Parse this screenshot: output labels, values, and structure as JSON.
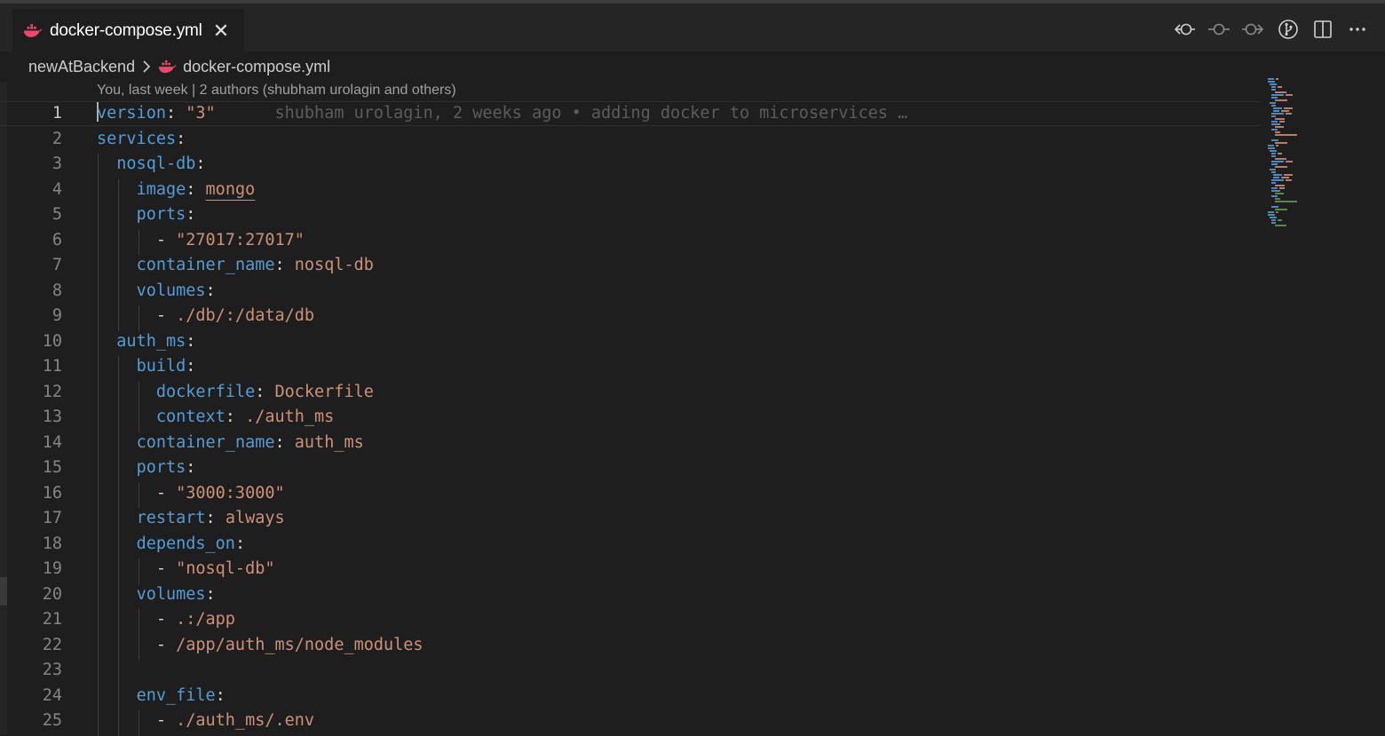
{
  "tab": {
    "label": "docker-compose.yml",
    "icon": "docker-whale-icon",
    "close_glyph": "✕"
  },
  "actions": [
    {
      "name": "open-previous-change-button",
      "icon": "arrow-left-commit-icon"
    },
    {
      "name": "open-changes-button",
      "icon": "commit-icon"
    },
    {
      "name": "open-next-change-button",
      "icon": "arrow-right-commit-icon"
    },
    {
      "name": "git-blame-toggle-button",
      "icon": "gitlens-icon"
    },
    {
      "name": "split-editor-button",
      "icon": "split-editor-icon"
    },
    {
      "name": "more-actions-button",
      "icon": "ellipsis-icon"
    }
  ],
  "breadcrumb": {
    "folder": "newAtBackend",
    "file": "docker-compose.yml"
  },
  "blame_header": "You, last week | 2 authors (shubham urolagin and others)",
  "inline_blame": "shubham urolagin, 2 weeks ago • adding docker to microservices …",
  "colors": {
    "key": "#569cd6",
    "string": "#ce9178",
    "punctuation": "#d4d4d4",
    "whale": "#f0466e"
  },
  "lines": [
    {
      "n": "1",
      "key": "version",
      "sep": ": ",
      "val": "\"3\""
    },
    {
      "n": "2",
      "key": "services",
      "sep": ":",
      "val": ""
    },
    {
      "n": "3",
      "indent": "  ",
      "key": "nosql-db",
      "sep": ":",
      "val": ""
    },
    {
      "n": "4",
      "indent": "    ",
      "key": "image",
      "sep": ": ",
      "val": "mongo"
    },
    {
      "n": "5",
      "indent": "    ",
      "key": "ports",
      "sep": ":",
      "val": ""
    },
    {
      "n": "6",
      "indent": "      ",
      "key": "",
      "sep": "- ",
      "val": "\"27017:27017\""
    },
    {
      "n": "7",
      "indent": "    ",
      "key": "container_name",
      "sep": ": ",
      "val": "nosql-db"
    },
    {
      "n": "8",
      "indent": "    ",
      "key": "volumes",
      "sep": ":",
      "val": ""
    },
    {
      "n": "9",
      "indent": "      ",
      "key": "",
      "sep": "- ",
      "val": "./db/:/data/db"
    },
    {
      "n": "10",
      "indent": "  ",
      "key": "auth_ms",
      "sep": ":",
      "val": ""
    },
    {
      "n": "11",
      "indent": "    ",
      "key": "build",
      "sep": ":",
      "val": ""
    },
    {
      "n": "12",
      "indent": "      ",
      "key": "dockerfile",
      "sep": ": ",
      "val": "Dockerfile"
    },
    {
      "n": "13",
      "indent": "      ",
      "key": "context",
      "sep": ": ",
      "val": "./auth_ms"
    },
    {
      "n": "14",
      "indent": "    ",
      "key": "container_name",
      "sep": ": ",
      "val": "auth_ms"
    },
    {
      "n": "15",
      "indent": "    ",
      "key": "ports",
      "sep": ":",
      "val": ""
    },
    {
      "n": "16",
      "indent": "      ",
      "key": "",
      "sep": "- ",
      "val": "\"3000:3000\""
    },
    {
      "n": "17",
      "indent": "    ",
      "key": "restart",
      "sep": ": ",
      "val": "always"
    },
    {
      "n": "18",
      "indent": "    ",
      "key": "depends_on",
      "sep": ":",
      "val": ""
    },
    {
      "n": "19",
      "indent": "      ",
      "key": "",
      "sep": "- ",
      "val": "\"nosql-db\""
    },
    {
      "n": "20",
      "indent": "    ",
      "key": "volumes",
      "sep": ":",
      "val": ""
    },
    {
      "n": "21",
      "indent": "      ",
      "key": "",
      "sep": "- ",
      "val": ".:/app"
    },
    {
      "n": "22",
      "indent": "      ",
      "key": "",
      "sep": "- ",
      "val": "/app/auth_ms/node_modules"
    },
    {
      "n": "23",
      "key": "",
      "sep": "",
      "val": ""
    },
    {
      "n": "24",
      "indent": "    ",
      "key": "env_file",
      "sep": ":",
      "val": ""
    },
    {
      "n": "25",
      "indent": "      ",
      "key": "",
      "sep": "- ",
      "val": "./auth_ms/.env"
    }
  ]
}
